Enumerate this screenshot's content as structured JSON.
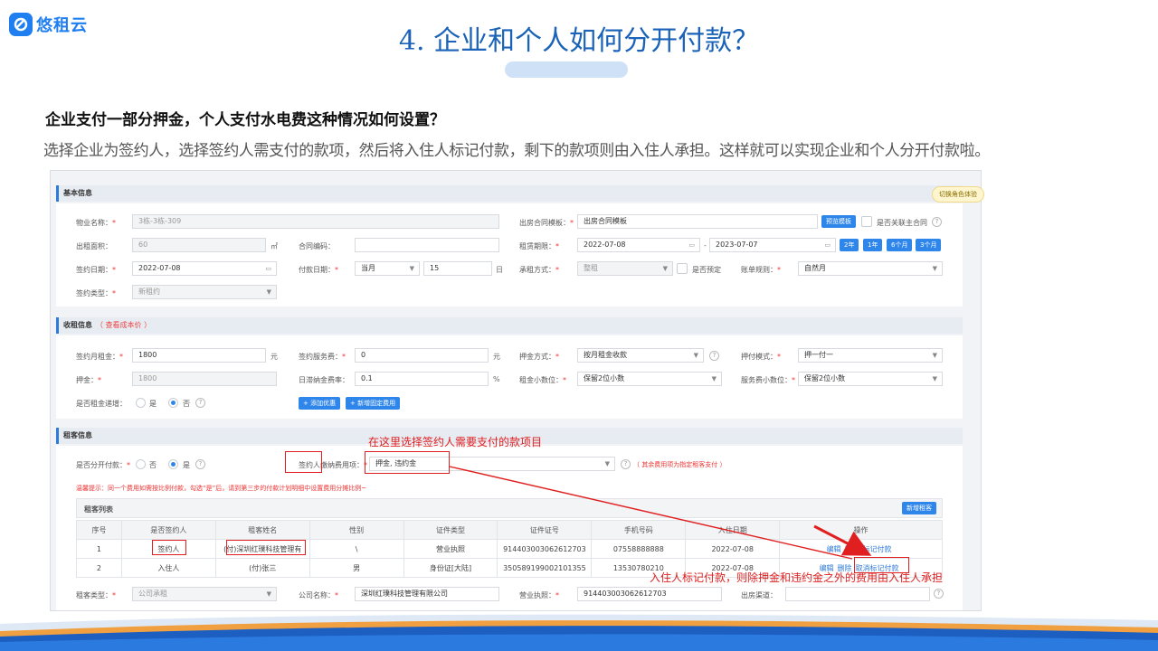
{
  "logo": {
    "text": "悠租云",
    "icon": "logo-mark-icon",
    "color": "#1f7ff0"
  },
  "slide": {
    "title": "4. 企业和个人如何分开付款？",
    "question": "企业支付一部分押金，个人支付水电费这种情况如何设置？",
    "answer": "选择企业为签约人，选择签约人需支付的款项，然后将入住人标记付款，剩下的款项则由入住人承担。这样就可以实现企业和个人分开付款啦。"
  },
  "tip": "切换角色体验",
  "basic": {
    "section": "基本信息",
    "property_label": "物业名称：",
    "property_value": "3栋-3栋-309",
    "area_label": "出租面积：",
    "area_value": "60",
    "area_unit": "㎡",
    "contract_no_label": "合同编码：",
    "contract_no_value": "",
    "sign_date_label": "签约日期：",
    "sign_date_value": "2022-07-08",
    "pay_day_label": "付款日期：",
    "pay_day_mode": "当月",
    "pay_day_value": "15",
    "pay_day_unit": "日",
    "sign_type_label": "签约类型：",
    "sign_type_value": "新租约",
    "template_label": "出房合同模板：",
    "template_value": "出房合同模板",
    "preview_button": "预览模板",
    "link_master_label": "是否关联主合同",
    "lease_label": "租赁期限：",
    "lease_start": "2022-07-08",
    "lease_sep": "-",
    "lease_end": "2023-07-07",
    "lease_quick": [
      "2年",
      "1年",
      "6个月",
      "3个月"
    ],
    "rent_mode_label": "承租方式：",
    "rent_mode_value": "整租",
    "reserve_label": "是否预定",
    "bill_rule_label": "账单规则：",
    "bill_rule_value": "自然月"
  },
  "rent": {
    "section": "收租信息",
    "section_sub": "（ 查看成本价 ）",
    "monthly_label": "签约月租金：",
    "monthly_value": "1800",
    "monthly_unit": "元",
    "deposit_label": "押金：",
    "deposit_value": "1800",
    "service_fee_label": "签约服务费：",
    "service_fee_value": "0",
    "service_fee_unit": "元",
    "late_fee_label": "日滞纳金费率：",
    "late_fee_value": "0.1",
    "late_fee_unit": "%",
    "increase_label": "是否租金递增：",
    "opt_yes": "是",
    "opt_no": "否",
    "add_discount_button": "+ 添加优惠",
    "add_fixed_fee_button": "+ 新增固定费用",
    "deposit_mode_label": "押金方式：",
    "deposit_mode_value": "按月租金收款",
    "rent_decimal_label": "租金小数位：",
    "rent_decimal_value": "保留2位小数",
    "pay_mode_label": "押付模式：",
    "pay_mode_value": "押一付一",
    "fee_decimal_label": "服务费小数位：",
    "fee_decimal_value": "保留2位小数"
  },
  "tenant": {
    "section": "租客信息",
    "split_label": "是否分开付款：",
    "opt_no": "否",
    "opt_yes": "是",
    "signer_fee_label": "签约人缴纳费用项：",
    "signer_fee_value": "押金, 违约金",
    "signer_fee_note": "（ 其余费用项为指定租客支付 ）",
    "warm_tip": "温馨提示：同一个费用如需按比例付款，勾选“是”后，请到第三步的付款计划明细中设置费用分摊比例~",
    "list_title": "租客列表",
    "add_tenant_button": "新增租客",
    "columns": [
      "序号",
      "是否签约人",
      "租客姓名",
      "性别",
      "证件类型",
      "证件证号",
      "手机号码",
      "入住日期",
      "操作"
    ],
    "rows": [
      {
        "no": "1",
        "signer": "签约人",
        "name": "(付)深圳红璞科技管理有",
        "gender": "\\",
        "id_type": "营业执照",
        "id_no": "914403003062612703",
        "phone": "07558888888",
        "date": "2022-07-08",
        "op_edit": "编辑",
        "op_delete": "删除",
        "op_mark": "标记付款"
      },
      {
        "no": "2",
        "signer": "入住人",
        "name": "(付)张三",
        "gender": "男",
        "id_type": "身份证[大陆]",
        "id_no": "350589199002101355",
        "phone": "13530780210",
        "date": "2022-07-08",
        "op_edit": "编辑",
        "op_delete": "删除",
        "op_mark": "取消标记付款"
      }
    ],
    "tenant_type_label": "租客类型：",
    "tenant_type_value": "公司承租",
    "company_label": "公司名称：",
    "company_value": "深圳红璞科技管理有限公司",
    "license_label": "营业执照：",
    "license_value": "914403003062612703",
    "channel_label": "出房渠道："
  },
  "annotations": {
    "top": "在这里选择签约人需要支付的款项目",
    "bottom": "入住人标记付款，则除押金和违约金之外的费用由入住人承担"
  },
  "colors": {
    "accent": "#2f86ea",
    "title": "#1a63b8",
    "annotation": "#e02020"
  }
}
